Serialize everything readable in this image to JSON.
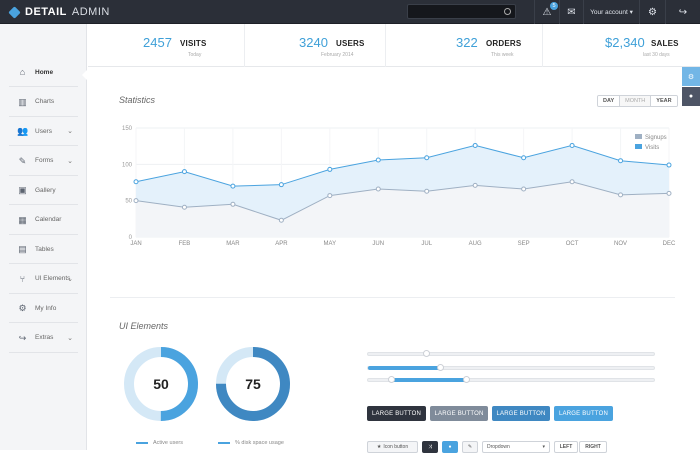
{
  "brand": {
    "name_bold": "DETAIL",
    "name_light": "ADMIN"
  },
  "topbar": {
    "search_placeholder": "",
    "alert_count": "5",
    "account_label": "Your account ▾"
  },
  "sidebar": {
    "items": [
      {
        "label": "Home",
        "icon": "home-icon",
        "glyph": "⌂",
        "chevron": false
      },
      {
        "label": "Charts",
        "icon": "bar-chart-icon",
        "glyph": "▥",
        "chevron": false
      },
      {
        "label": "Users",
        "icon": "users-icon",
        "glyph": "👥",
        "chevron": true
      },
      {
        "label": "Forms",
        "icon": "edit-icon",
        "glyph": "✎",
        "chevron": true
      },
      {
        "label": "Gallery",
        "icon": "image-icon",
        "glyph": "▣",
        "chevron": false
      },
      {
        "label": "Calendar",
        "icon": "calendar-icon",
        "glyph": "▦",
        "chevron": false
      },
      {
        "label": "Tables",
        "icon": "table-icon",
        "glyph": "▤",
        "chevron": false
      },
      {
        "label": "UI Elements",
        "icon": "branch-icon",
        "glyph": "⑂",
        "chevron": true
      },
      {
        "label": "My Info",
        "icon": "gear-icon",
        "glyph": "⚙",
        "chevron": false
      },
      {
        "label": "Extras",
        "icon": "share-icon",
        "glyph": "↪",
        "chevron": true
      }
    ]
  },
  "stats": [
    {
      "value": "2457",
      "label": "VISITS",
      "sub": "Today"
    },
    {
      "value": "3240",
      "label": "USERS",
      "sub": "February 2014"
    },
    {
      "value": "322",
      "label": "ORDERS",
      "sub": "This week"
    },
    {
      "value": "$2,340",
      "label": "SALES",
      "sub": "last 30 days"
    }
  ],
  "statistics": {
    "title": "Statistics",
    "ranges": [
      "DAY",
      "MONTH",
      "YEAR"
    ]
  },
  "chart_data": {
    "type": "area",
    "categories": [
      "JAN",
      "FEB",
      "MAR",
      "APR",
      "MAY",
      "JUN",
      "JUL",
      "AUG",
      "SEP",
      "OCT",
      "NOV",
      "DEC"
    ],
    "series": [
      {
        "name": "Signups",
        "color": "#9fb0c3",
        "values": [
          50,
          41,
          45,
          23,
          57,
          66,
          63,
          71,
          66,
          76,
          58,
          60
        ]
      },
      {
        "name": "Visits",
        "color": "#4aa3df",
        "values": [
          76,
          90,
          70,
          72,
          93,
          106,
          109,
          126,
          109,
          126,
          105,
          99
        ]
      }
    ],
    "yticks": [
      "0",
      "50",
      "100",
      "150"
    ],
    "ylim": [
      0,
      150
    ],
    "grid": true,
    "legend": "top-right"
  },
  "ui_elements": {
    "title": "UI Elements",
    "donuts": [
      {
        "value": "50",
        "percent": 50,
        "legend": "Active users",
        "color": "#4aa3df",
        "track": "#d4e8f6"
      },
      {
        "value": "75",
        "percent": 75,
        "legend": "% disk space usage",
        "color": "#3f88c2",
        "track": "#d4e8f6"
      }
    ],
    "sliders": [
      {
        "start": 0.2,
        "end": 0.2,
        "show_fill": false
      },
      {
        "start": 0.0,
        "end": 0.25,
        "show_fill": true
      },
      {
        "start": 0.08,
        "end": 0.34,
        "show_fill": true
      }
    ],
    "large_buttons": [
      "LARGE BUTTON",
      "LARGE BUTTON",
      "LARGE BUTTON",
      "LARGE BUTTON"
    ],
    "small_controls": {
      "icon_button": "Icon button",
      "dropdown": "Dropdown",
      "left": "LEFT",
      "right": "RIGHT"
    }
  }
}
